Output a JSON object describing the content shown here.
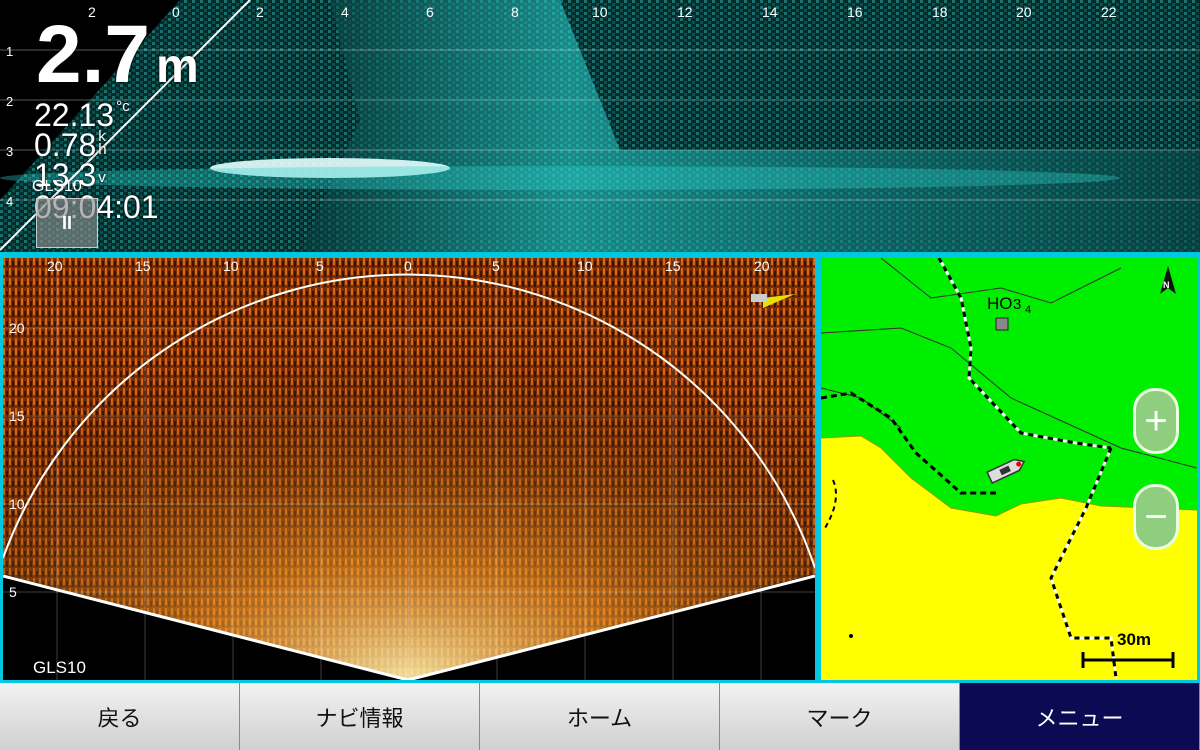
{
  "top_sonar": {
    "range_labels": [
      "2",
      "0",
      "2",
      "4",
      "6",
      "8",
      "10",
      "12",
      "14",
      "16",
      "18",
      "20",
      "22"
    ],
    "depth_labels": [
      "1",
      "2",
      "3",
      "4"
    ],
    "depth_value": "2.7",
    "depth_unit": "m",
    "water_temp": "22.13",
    "water_temp_unit": "°c",
    "speed": "0.78",
    "speed_unit": "k\nh",
    "voltage": "13.3",
    "voltage_unit": "v",
    "source": "GLS10",
    "time": "09:04:01",
    "pause_symbol": "II"
  },
  "fan_sonar": {
    "range_labels": [
      "20",
      "15",
      "10",
      "5",
      "0",
      "5",
      "10",
      "15",
      "20"
    ],
    "depth_labels": [
      "20",
      "15",
      "10",
      "5"
    ],
    "source": "GLS10"
  },
  "chart": {
    "north_label": "N",
    "marker_label": "HO",
    "depth_mark_main": "3",
    "depth_mark_sub": "4",
    "zoom_in": "+",
    "zoom_out": "−",
    "scale_label": "30m"
  },
  "bottom_bar": {
    "back": "戻る",
    "nav_info": "ナビ情報",
    "home": "ホーム",
    "mark": "マーク",
    "menu": "メニュー"
  },
  "colors": {
    "frame": "#00c8e0",
    "sonar_cyan": "#2fd3cf",
    "fan_orange": "#c85a10",
    "land_green": "#00ee00",
    "land_yellow": "#ffff00",
    "menu_active": "#0c0a52"
  }
}
